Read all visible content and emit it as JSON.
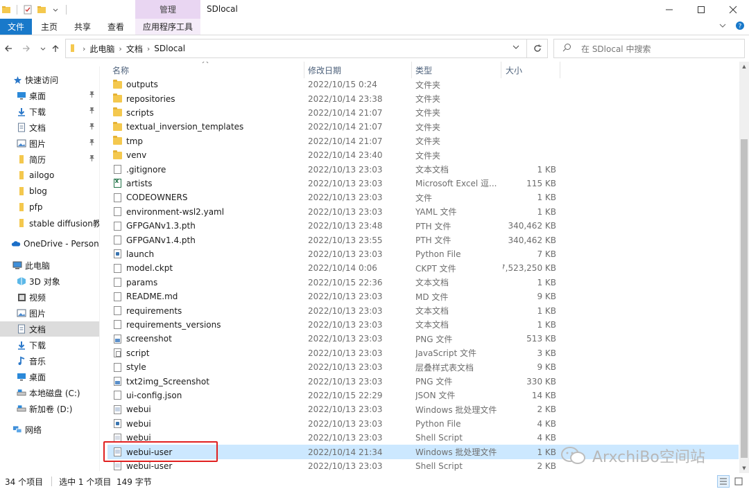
{
  "titlebar": {
    "title": "SDlocal",
    "contextual_tab": "管理"
  },
  "ribbon": {
    "tabs": [
      "文件",
      "主页",
      "共享",
      "查看",
      "应用程序工具"
    ],
    "help": "?"
  },
  "address": {
    "crumbs": [
      "此电脑",
      "文档",
      "SDlocal"
    ],
    "search_placeholder": "在 SDlocal 中搜索"
  },
  "nav": {
    "items": [
      {
        "label": "快速访问",
        "icon": "star-icon",
        "pinned": false
      },
      {
        "label": "桌面",
        "icon": "desktop-icon",
        "pinned": true
      },
      {
        "label": "下载",
        "icon": "download-icon",
        "pinned": true
      },
      {
        "label": "文档",
        "icon": "document-icon",
        "pinned": true
      },
      {
        "label": "图片",
        "icon": "picture-icon",
        "pinned": true
      },
      {
        "label": "简历",
        "icon": "folder-icon",
        "pinned": true
      },
      {
        "label": "ailogo",
        "icon": "folder-icon",
        "pinned": false
      },
      {
        "label": "blog",
        "icon": "folder-icon",
        "pinned": false
      },
      {
        "label": "pfp",
        "icon": "folder-icon",
        "pinned": false
      },
      {
        "label": "stable diffusion教程",
        "icon": "folder-icon",
        "pinned": false
      },
      {
        "label": "OneDrive - Personal",
        "icon": "cloud-icon",
        "pinned": false
      },
      {
        "label": "此电脑",
        "icon": "computer-icon",
        "pinned": false
      },
      {
        "label": "3D 对象",
        "icon": "cube-icon",
        "pinned": false
      },
      {
        "label": "视频",
        "icon": "video-icon",
        "pinned": false
      },
      {
        "label": "图片",
        "icon": "picture-icon",
        "pinned": false
      },
      {
        "label": "文档",
        "icon": "document-icon",
        "pinned": false
      },
      {
        "label": "下载",
        "icon": "download-icon",
        "pinned": false
      },
      {
        "label": "音乐",
        "icon": "music-icon",
        "pinned": false
      },
      {
        "label": "桌面",
        "icon": "desktop-icon",
        "pinned": false
      },
      {
        "label": "本地磁盘 (C:)",
        "icon": "drive-icon",
        "pinned": false
      },
      {
        "label": "新加卷 (D:)",
        "icon": "drive-icon",
        "pinned": false
      },
      {
        "label": "网络",
        "icon": "network-icon",
        "pinned": false
      }
    ],
    "selected_index": 15
  },
  "columns": {
    "name": "名称",
    "date": "修改日期",
    "type": "类型",
    "size": "大小"
  },
  "files": [
    {
      "name": "outputs",
      "date": "2022/10/15 0:24",
      "type": "文件夹",
      "size": "",
      "icon": "folder-icon"
    },
    {
      "name": "repositories",
      "date": "2022/10/14 23:38",
      "type": "文件夹",
      "size": "",
      "icon": "folder-icon"
    },
    {
      "name": "scripts",
      "date": "2022/10/14 21:07",
      "type": "文件夹",
      "size": "",
      "icon": "folder-icon"
    },
    {
      "name": "textual_inversion_templates",
      "date": "2022/10/14 21:07",
      "type": "文件夹",
      "size": "",
      "icon": "folder-icon"
    },
    {
      "name": "tmp",
      "date": "2022/10/14 21:07",
      "type": "文件夹",
      "size": "",
      "icon": "folder-icon"
    },
    {
      "name": "venv",
      "date": "2022/10/14 23:40",
      "type": "文件夹",
      "size": "",
      "icon": "folder-icon"
    },
    {
      "name": ".gitignore",
      "date": "2022/10/13 23:03",
      "type": "文本文档",
      "size": "1 KB",
      "icon": "text-file-icon"
    },
    {
      "name": "artists",
      "date": "2022/10/13 23:03",
      "type": "Microsoft Excel 逗...",
      "size": "115 KB",
      "icon": "excel-file-icon"
    },
    {
      "name": "CODEOWNERS",
      "date": "2022/10/13 23:03",
      "type": "文件",
      "size": "1 KB",
      "icon": "file-icon"
    },
    {
      "name": "environment-wsl2.yaml",
      "date": "2022/10/13 23:03",
      "type": "YAML 文件",
      "size": "1 KB",
      "icon": "file-icon"
    },
    {
      "name": "GFPGANv1.3.pth",
      "date": "2022/10/13 23:48",
      "type": "PTH 文件",
      "size": "340,462 KB",
      "icon": "file-icon"
    },
    {
      "name": "GFPGANv1.4.pth",
      "date": "2022/10/13 23:55",
      "type": "PTH 文件",
      "size": "340,462 KB",
      "icon": "file-icon"
    },
    {
      "name": "launch",
      "date": "2022/10/13 23:03",
      "type": "Python File",
      "size": "7 KB",
      "icon": "python-file-icon"
    },
    {
      "name": "model.ckpt",
      "date": "2022/10/14 0:06",
      "type": "CKPT 文件",
      "size": "7,523,250 KB",
      "icon": "file-icon"
    },
    {
      "name": "params",
      "date": "2022/10/15 22:36",
      "type": "文本文档",
      "size": "1 KB",
      "icon": "text-file-icon"
    },
    {
      "name": "README.md",
      "date": "2022/10/13 23:03",
      "type": "MD 文件",
      "size": "9 KB",
      "icon": "file-icon"
    },
    {
      "name": "requirements",
      "date": "2022/10/13 23:03",
      "type": "文本文档",
      "size": "1 KB",
      "icon": "text-file-icon"
    },
    {
      "name": "requirements_versions",
      "date": "2022/10/13 23:03",
      "type": "文本文档",
      "size": "1 KB",
      "icon": "text-file-icon"
    },
    {
      "name": "screenshot",
      "date": "2022/10/13 23:03",
      "type": "PNG 文件",
      "size": "513 KB",
      "icon": "image-file-icon"
    },
    {
      "name": "script",
      "date": "2022/10/13 23:03",
      "type": "JavaScript 文件",
      "size": "3 KB",
      "icon": "js-file-icon"
    },
    {
      "name": "style",
      "date": "2022/10/13 23:03",
      "type": "层叠样式表文档",
      "size": "9 KB",
      "icon": "css-file-icon"
    },
    {
      "name": "txt2img_Screenshot",
      "date": "2022/10/13 23:03",
      "type": "PNG 文件",
      "size": "330 KB",
      "icon": "image-file-icon"
    },
    {
      "name": "ui-config.json",
      "date": "2022/10/15 22:29",
      "type": "JSON 文件",
      "size": "14 KB",
      "icon": "file-icon"
    },
    {
      "name": "webui",
      "date": "2022/10/13 23:03",
      "type": "Windows 批处理文件",
      "size": "2 KB",
      "icon": "batch-file-icon"
    },
    {
      "name": "webui",
      "date": "2022/10/13 23:03",
      "type": "Python File",
      "size": "4 KB",
      "icon": "python-file-icon"
    },
    {
      "name": "webui",
      "date": "2022/10/13 23:03",
      "type": "Shell Script",
      "size": "4 KB",
      "icon": "shell-file-icon"
    },
    {
      "name": "webui-user",
      "date": "2022/10/14 21:34",
      "type": "Windows 批处理文件",
      "size": "1 KB",
      "icon": "batch-file-icon"
    },
    {
      "name": "webui-user",
      "date": "2022/10/13 23:03",
      "type": "Shell Script",
      "size": "2 KB",
      "icon": "shell-file-icon"
    }
  ],
  "selected_file_index": 26,
  "status": {
    "count": "34 个项目",
    "selection": "选中 1 个项目  149 字节"
  },
  "watermark": {
    "text": "ArxchiBo空间站"
  },
  "colors": {
    "accent": "#1979ca",
    "selection": "#cce8ff",
    "highlight_box": "#e02020",
    "context_tab": "#e9d6f2"
  }
}
